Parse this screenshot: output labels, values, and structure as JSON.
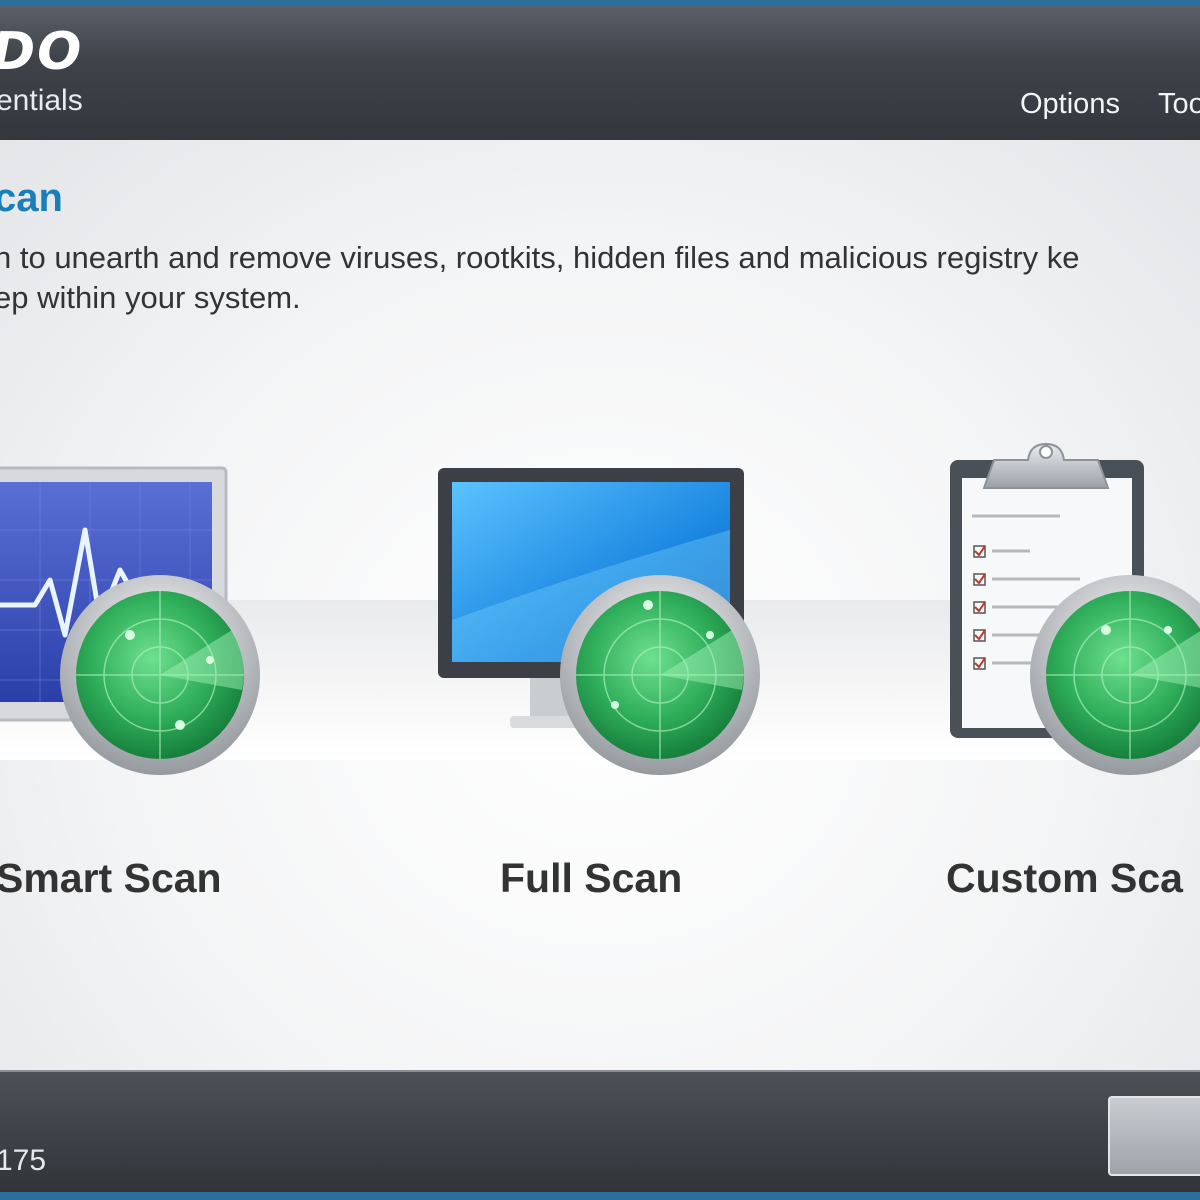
{
  "app": {
    "logo_text": "DO",
    "logo_subtitle": "entials"
  },
  "menu": {
    "options_label": "Options",
    "tools_label": "Too"
  },
  "page": {
    "title": "can",
    "description_line1": "n to unearth and remove viruses, rootkits, hidden files and malicious registry ke",
    "description_line2": "ep within your system."
  },
  "scan_options": [
    {
      "label": "Smart Scan",
      "icon": "monitor-heartbeat-radar-icon"
    },
    {
      "label": "Full Scan",
      "icon": "monitor-radar-icon"
    },
    {
      "label": "Custom Sca",
      "icon": "clipboard-radar-icon"
    }
  ],
  "footer": {
    "version_text": "175"
  },
  "colors": {
    "accent_blue": "#1a7fb8",
    "radar_green": "#2fae5a",
    "header_dark": "#3e434a"
  }
}
